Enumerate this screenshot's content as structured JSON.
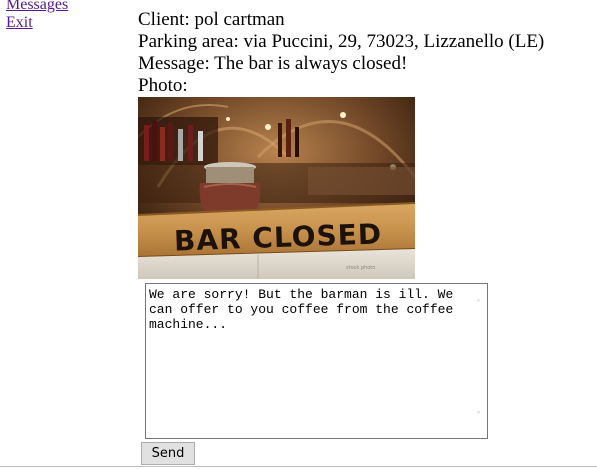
{
  "nav": {
    "messages_label": "Messages",
    "exit_label": "Exit"
  },
  "details": {
    "client": "Client: pol cartman",
    "parking_area": "Parking area: via Puccini, 29, 73023, Lizzanello (LE)",
    "message": "Message: The bar is always closed!",
    "photo_label": "Photo:"
  },
  "photo": {
    "sign_text": "BAR CLOSED",
    "watermark": "stock photo"
  },
  "reply": {
    "value": "We are sorry! But the barman is ill. We can offer to you coffee from the coffee machine..."
  },
  "actions": {
    "send_label": "Send"
  },
  "colors": {
    "link": "#551a8b",
    "button_bg": "#e1e1e1",
    "button_border": "#adadad"
  },
  "icons": {
    "scroll_up": "chevron-up-icon",
    "scroll_down": "chevron-down-icon"
  }
}
